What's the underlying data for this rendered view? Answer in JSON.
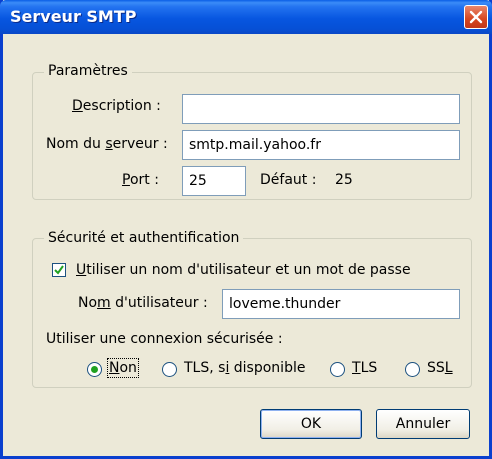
{
  "window": {
    "title": "Serveur SMTP"
  },
  "parametres": {
    "legend": "Paramètres",
    "description_label": "Description :",
    "description_value": "",
    "server_label": "Nom du serveur :",
    "server_value": "smtp.mail.yahoo.fr",
    "port_label": "Port :",
    "port_value": "25",
    "default_label": "Défaut :",
    "default_value": "25"
  },
  "securite": {
    "legend": "Sécurité et authentification",
    "use_auth_label": "Utiliser un nom d'utilisateur et un mot de passe",
    "use_auth_checked": true,
    "username_label": "Nom d'utilisateur :",
    "username_value": "loveme.thunder",
    "secure_conn_label": "Utiliser une connexion sécurisée :",
    "options": [
      "Non",
      "TLS, si disponible",
      "TLS",
      "SSL"
    ],
    "selected_option": "Non"
  },
  "buttons": {
    "ok": "OK",
    "cancel": "Annuler"
  },
  "colors": {
    "title_bar": "#0756e0",
    "close_button": "#d6461f",
    "dialog_bg": "#ece9d8"
  }
}
